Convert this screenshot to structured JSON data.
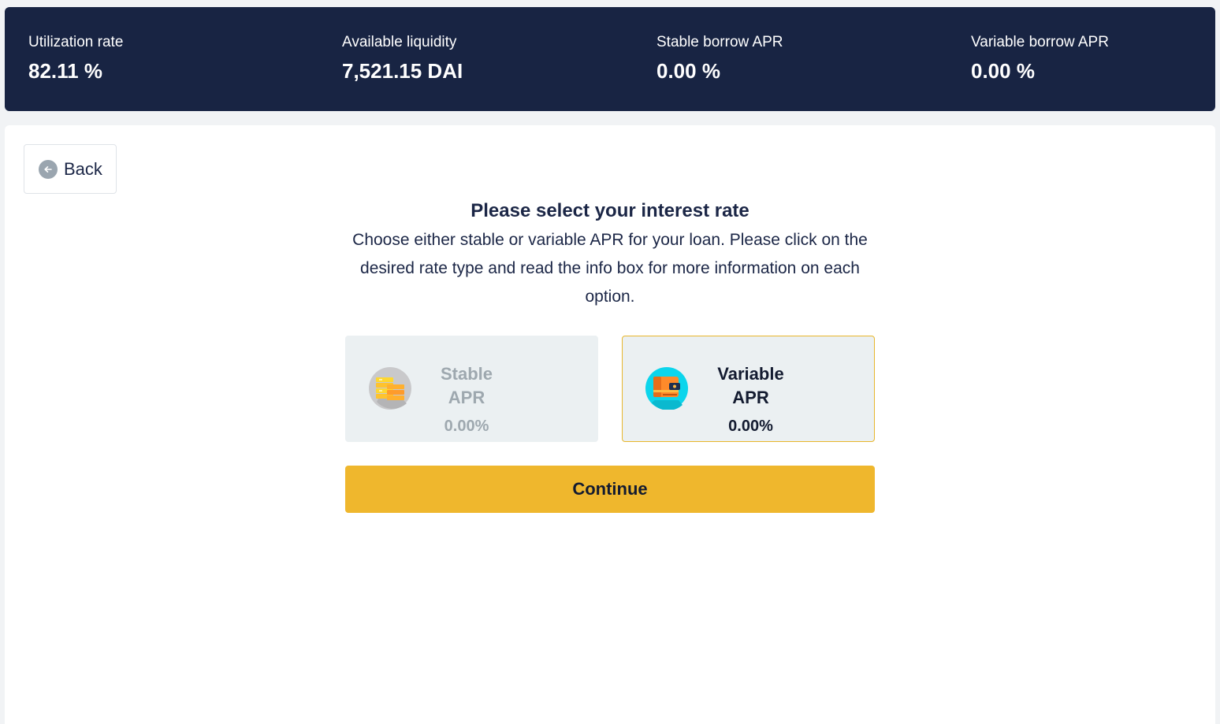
{
  "stats": [
    {
      "label": "Utilization rate",
      "value": "82.11 %"
    },
    {
      "label": "Available liquidity",
      "value": "7,521.15 DAI"
    },
    {
      "label": "Stable borrow APR",
      "value": "0.00 %"
    },
    {
      "label": "Variable borrow APR",
      "value": "0.00 %"
    }
  ],
  "back": {
    "label": "Back",
    "icon": "arrow-left-icon"
  },
  "main": {
    "title": "Please select your interest rate",
    "description": "Choose either stable or variable APR for your loan. Please click on the desired rate type and read the info box for more information on each option."
  },
  "options": [
    {
      "title": "Stable APR",
      "value": "0.00%",
      "icon": "stable-coins-icon",
      "selected": false
    },
    {
      "title": "Variable APR",
      "value": "0.00%",
      "icon": "variable-wallet-icon",
      "selected": true
    }
  ],
  "continue_label": "Continue",
  "colors": {
    "header_bg": "#182443",
    "accent": "#efb72d",
    "selected_border": "#e8b72c",
    "card_bg": "#ebf0f2",
    "muted_text": "#9ea8af"
  }
}
